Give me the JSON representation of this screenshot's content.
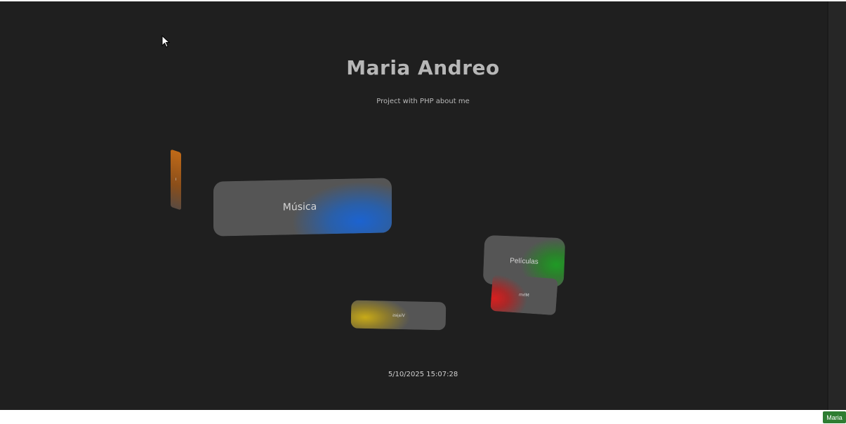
{
  "header": {
    "title": "Maria Andreo",
    "subtitle": "Project with PHP about me"
  },
  "cards": {
    "musica": "Música",
    "peliculas": "Películas",
    "mini": "Mhm",
    "viajes": "Viajes",
    "side": "I"
  },
  "footer": {
    "timestamp": "5/10/2025 15:07:28"
  },
  "badge": {
    "label": "Maria"
  },
  "colors": {
    "background": "#1f1f1f",
    "title": "#b7b7b7",
    "musica_accent": "#1c63d0",
    "peliculas_accent": "#1f9a25",
    "mini_accent": "#d81f1f",
    "viajes_accent": "#c8aa18",
    "side_accent": "#c06a18",
    "badge": "#2e7d32"
  },
  "icons": {
    "cursor": "mouse-pointer-icon"
  }
}
